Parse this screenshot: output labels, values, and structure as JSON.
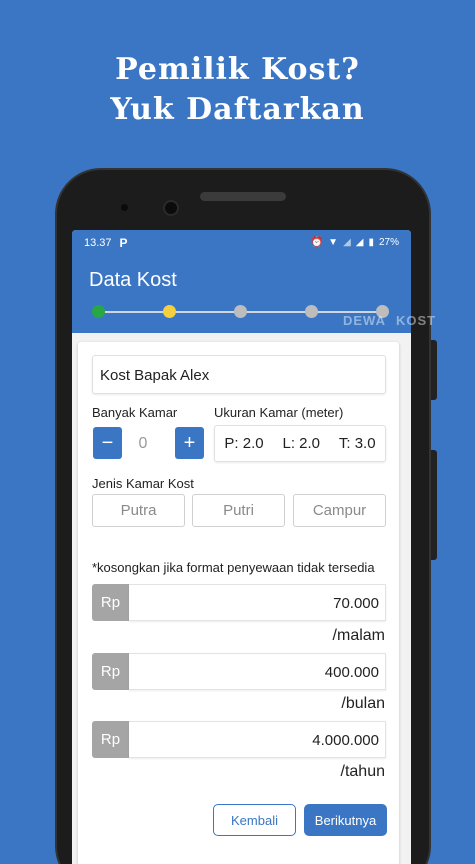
{
  "promo": {
    "line1": "Pemilik Kost?",
    "line2": "Yuk Daftarkan"
  },
  "status_bar": {
    "time": "13.37",
    "app_icon": "P",
    "battery": "27%"
  },
  "app_bar": {
    "title": "Data Kost"
  },
  "stepper": {
    "steps": 5,
    "current": 2,
    "colors": {
      "done": "#28a745",
      "current": "#f4d03f",
      "pending": "#bdbdbd"
    }
  },
  "watermark": {
    "left": "DEWA",
    "right": "KOST"
  },
  "form": {
    "name_value": "Kost Bapak Alex",
    "rooms_label": "Banyak Kamar",
    "rooms_value": "0",
    "minus": "−",
    "plus": "+",
    "size_label": "Ukuran Kamar (meter)",
    "size_p": "P: 2.0",
    "size_l": "L: 2.0",
    "size_t": "T: 3.0",
    "type_label": "Jenis Kamar Kost",
    "types": [
      "Putra",
      "Putri",
      "Campur"
    ],
    "note": "*kosongkan jika format penyewaan tidak tersedia",
    "prices": [
      {
        "currency": "Rp",
        "value": "70.000",
        "unit": "/malam"
      },
      {
        "currency": "Rp",
        "value": "400.000",
        "unit": "/bulan"
      },
      {
        "currency": "Rp",
        "value": "4.000.000",
        "unit": "/tahun"
      }
    ],
    "back_label": "Kembali",
    "next_label": "Berikutnya"
  },
  "colors": {
    "brand": "#3a76c4",
    "rp_tag": "#a5a5a5"
  }
}
